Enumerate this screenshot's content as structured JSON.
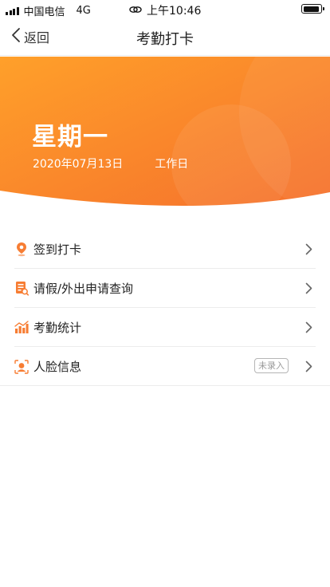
{
  "status_bar": {
    "carrier": "中国电信",
    "network": "4G",
    "time": "上午10:46"
  },
  "nav": {
    "back_label": "返回",
    "title": "考勤打卡"
  },
  "banner": {
    "weekday": "星期一",
    "date": "2020年07月13日",
    "day_type": "工作日"
  },
  "menu": {
    "items": [
      {
        "label": "签到打卡",
        "icon": "location-pin-icon"
      },
      {
        "label": "请假/外出申请查询",
        "icon": "document-search-icon"
      },
      {
        "label": "考勤统计",
        "icon": "bar-chart-icon"
      },
      {
        "label": "人脸信息",
        "icon": "face-scan-icon",
        "badge": "未录入"
      }
    ]
  },
  "colors": {
    "accent": "#f77d33",
    "banner_light": "#ffa02a",
    "banner_dark": "#f5702c"
  }
}
